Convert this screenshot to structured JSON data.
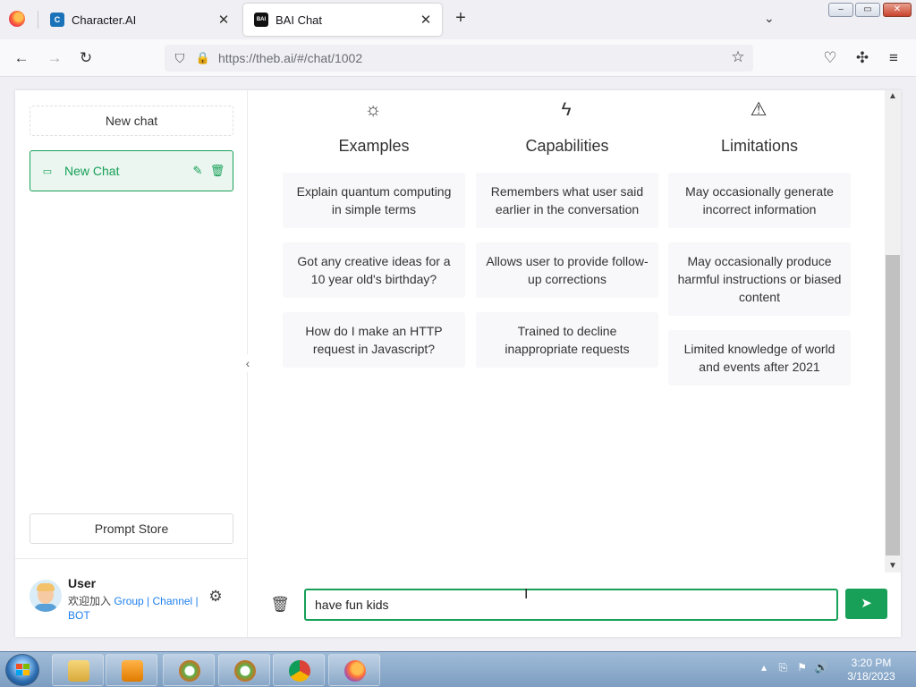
{
  "browser": {
    "tabs": [
      {
        "title": "Character.AI",
        "favicon": "C",
        "active": false
      },
      {
        "title": "BAI Chat",
        "favicon": "BAI",
        "active": true
      }
    ],
    "url": "https://theb.ai/#/chat/1002",
    "icons": {
      "back": "←",
      "forward": "→",
      "reload": "↻",
      "shield": "⛉",
      "lock": "🔒",
      "star": "☆",
      "pocket": "♡",
      "extensions": "✣",
      "menu": "≡",
      "new_tab": "+",
      "tab_close": "✕",
      "list_tabs": "⌄",
      "win_min": "–",
      "win_max": "▭",
      "win_close": "✕"
    }
  },
  "sidebar": {
    "new_chat_label": "New chat",
    "chats": [
      {
        "title": "New Chat",
        "selected": true
      }
    ],
    "prompt_store_label": "Prompt Store",
    "user": {
      "name": "User",
      "join_text": "欢迎加入",
      "links": [
        "Group",
        "Channel",
        "BOT"
      ],
      "separator": " | "
    },
    "icons": {
      "chat": "▭",
      "edit": "✎",
      "delete": "🗑",
      "settings": "⚙",
      "collapse": "‹"
    }
  },
  "main": {
    "columns": [
      {
        "icon": "☼",
        "title": "Examples",
        "cards": [
          "Explain quantum computing in simple terms",
          "Got any creative ideas for a 10 year old's birthday?",
          "How do I make an HTTP request in Javascript?"
        ]
      },
      {
        "icon": "ϟ",
        "title": "Capabilities",
        "cards": [
          "Remembers what user said earlier in the conversation",
          "Allows user to provide follow-up corrections",
          "Trained to decline inappropriate requests"
        ]
      },
      {
        "icon": "⚠",
        "title": "Limitations",
        "cards": [
          "May occasionally generate incorrect information",
          "May occasionally produce harmful instructions or biased content",
          "Limited knowledge of world and events after 2021"
        ]
      }
    ],
    "input": {
      "value": "have fun kids"
    },
    "icons": {
      "trash": "🗑",
      "send": "➤"
    }
  },
  "taskbar": {
    "time": "3:20 PM",
    "date": "3/18/2023",
    "tray_icons": [
      "▴",
      "⎘",
      "⚑",
      "🔊"
    ]
  },
  "colors": {
    "accent": "#18a058",
    "link": "#2080f0",
    "card_bg": "#f8f8fa"
  }
}
